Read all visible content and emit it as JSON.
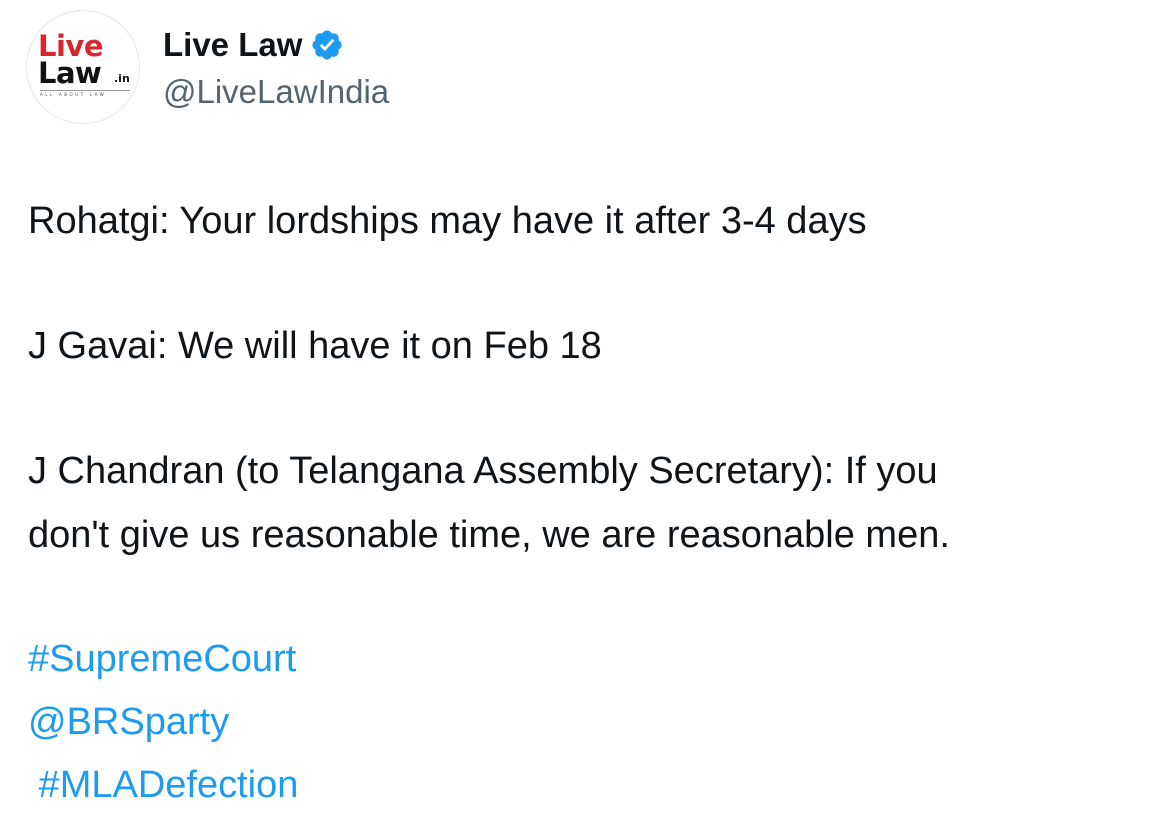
{
  "author": {
    "display_name": "Live Law",
    "handle": "@LiveLawIndia",
    "verified": true,
    "avatar_logo": {
      "line1": "Live",
      "line2": "Law",
      "suffix": ".in",
      "tagline": "ALL ABOUT LAW",
      "brand_color": "#d7262e"
    }
  },
  "tweet": {
    "lines": [
      "Rohatgi: Your lordships may have it after 3-4 days",
      "J Gavai: We will have it on Feb 18",
      "J Chandran (to Telangana Assembly Secretary): If you",
      "don't give us reasonable time, we are reasonable men."
    ],
    "links": [
      "#SupremeCourt",
      "@BRSparty",
      " #MLADefection"
    ]
  },
  "colors": {
    "text": "#0f1419",
    "secondary_text": "#536471",
    "link": "#1d9bf0",
    "verified_badge": "#1d9bf0"
  },
  "icons": {
    "verified": "verified-badge-icon"
  }
}
